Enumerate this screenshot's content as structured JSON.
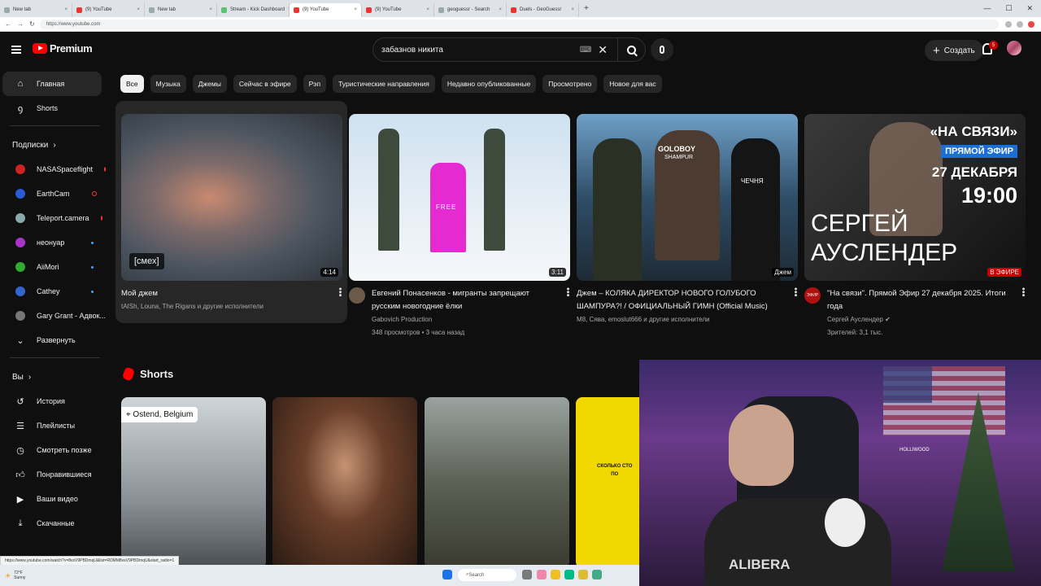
{
  "browser": {
    "tabs": [
      {
        "label": "New tab",
        "active": false
      },
      {
        "label": "(9) YouTube",
        "active": false
      },
      {
        "label": "New tab",
        "active": false
      },
      {
        "label": "Stream - Kick Dashboard",
        "active": false
      },
      {
        "label": "(9) YouTube",
        "active": true
      },
      {
        "label": "(9) YouTube",
        "active": false
      },
      {
        "label": "geoguessr - Search",
        "active": false
      },
      {
        "label": "Duels - GeoGuessr",
        "active": false
      }
    ],
    "url": "https://www.youtube.com"
  },
  "header": {
    "logo_text": "Premium",
    "search_value": "забазнов никита",
    "create_label": "Создать",
    "notifications": "5"
  },
  "sidebar": {
    "items": [
      {
        "label": "Главная",
        "icon": "home-icon"
      },
      {
        "label": "Shorts",
        "icon": "shorts-icon"
      }
    ],
    "subs_heading": "Подписки",
    "subscriptions": [
      {
        "label": "NASASpaceflight",
        "color": "#c22",
        "status": "live"
      },
      {
        "label": "EarthCam",
        "color": "#2a5bd7",
        "status": "live"
      },
      {
        "label": "Teleport.camera",
        "color": "#8aa",
        "status": "live"
      },
      {
        "label": "неонуар",
        "color": "#a3c",
        "status": "new"
      },
      {
        "label": "AiiMori",
        "color": "#3a3",
        "status": "new"
      },
      {
        "label": "Cathey",
        "color": "#36c",
        "status": "new"
      },
      {
        "label": "Gary Grant - Адвок...",
        "color": "#777",
        "status": ""
      }
    ],
    "expand_label": "Развернуть",
    "you_heading": "Вы",
    "you_items": [
      {
        "label": "История",
        "icon": "history-icon"
      },
      {
        "label": "Плейлисты",
        "icon": "playlist-icon"
      },
      {
        "label": "Смотреть позже",
        "icon": "clock-icon"
      },
      {
        "label": "Понравившиеся",
        "icon": "thumb-up-icon"
      },
      {
        "label": "Ваши видео",
        "icon": "video-icon"
      },
      {
        "label": "Скачанные",
        "icon": "download-icon"
      }
    ]
  },
  "chips": [
    "Все",
    "Музыка",
    "Джемы",
    "Сейчас в эфире",
    "Рэп",
    "Туристические направления",
    "Недавно опубликованные",
    "Просмотрено",
    "Новое для вас"
  ],
  "videos": [
    {
      "title": "Мой джем",
      "line2": "tAISh, Louna, The Rigans и другие исполнители",
      "line3": "",
      "duration": "4:14",
      "overlay": "[смех]"
    },
    {
      "title": "Евгений Понасенков - мигранты запрещают русским новогодние ёлки",
      "line2": "Gabovich Production",
      "line3": "348 просмотров • 3 часа назад",
      "duration": "3:11",
      "shirt": "FREE"
    },
    {
      "title": "Джем – КОЛЯКА ДИРЕКТОР НОВОГО ГОЛУБОГО ШАМПУРА?! / ОФИЦИАЛЬНЫЙ ГИМН (Official Music)",
      "line2": "M8, Сява, emoslut666 и другие исполнители",
      "line3": "",
      "duration": "Джем",
      "sign1": "GOLOBOY",
      "sign2": "SHAMPUR",
      "shirt": "ЧЕЧНЯ"
    },
    {
      "title": "\"На связи\". Прямой Эфир 27 декабря 2025. Итоги года",
      "line2": "Сергей Ауслендер",
      "line3": "Зрителей: 3,1 тыс.",
      "duration": "В ЭФИРЕ",
      "avatar_text": "ЭФИР",
      "t1": "«НА СВЯЗИ»",
      "t2": "ПРЯМОЙ ЭФИР",
      "t3": "27 ДЕКАБРЯ",
      "t4": "19:00",
      "t5": "СЕРГЕЙ",
      "t6": "АУСЛЕНДЕР"
    }
  ],
  "shorts": {
    "heading": "Shorts",
    "location": "Ostend, Belgium",
    "card4_text1": "СКОЛЬКО СТО",
    "card4_text2": "ПО"
  },
  "webcam": {
    "sign": "HOLLIWOOD",
    "shirt": "ALIBERA"
  },
  "status_url": "https://www.youtube.com/watch?v=8vsV9PBDmqU&list=RDMM8vsV9PBDmqU&start_radio=1",
  "taskbar": {
    "temp": "72°F",
    "weather": "Sunny",
    "search": "Search"
  }
}
